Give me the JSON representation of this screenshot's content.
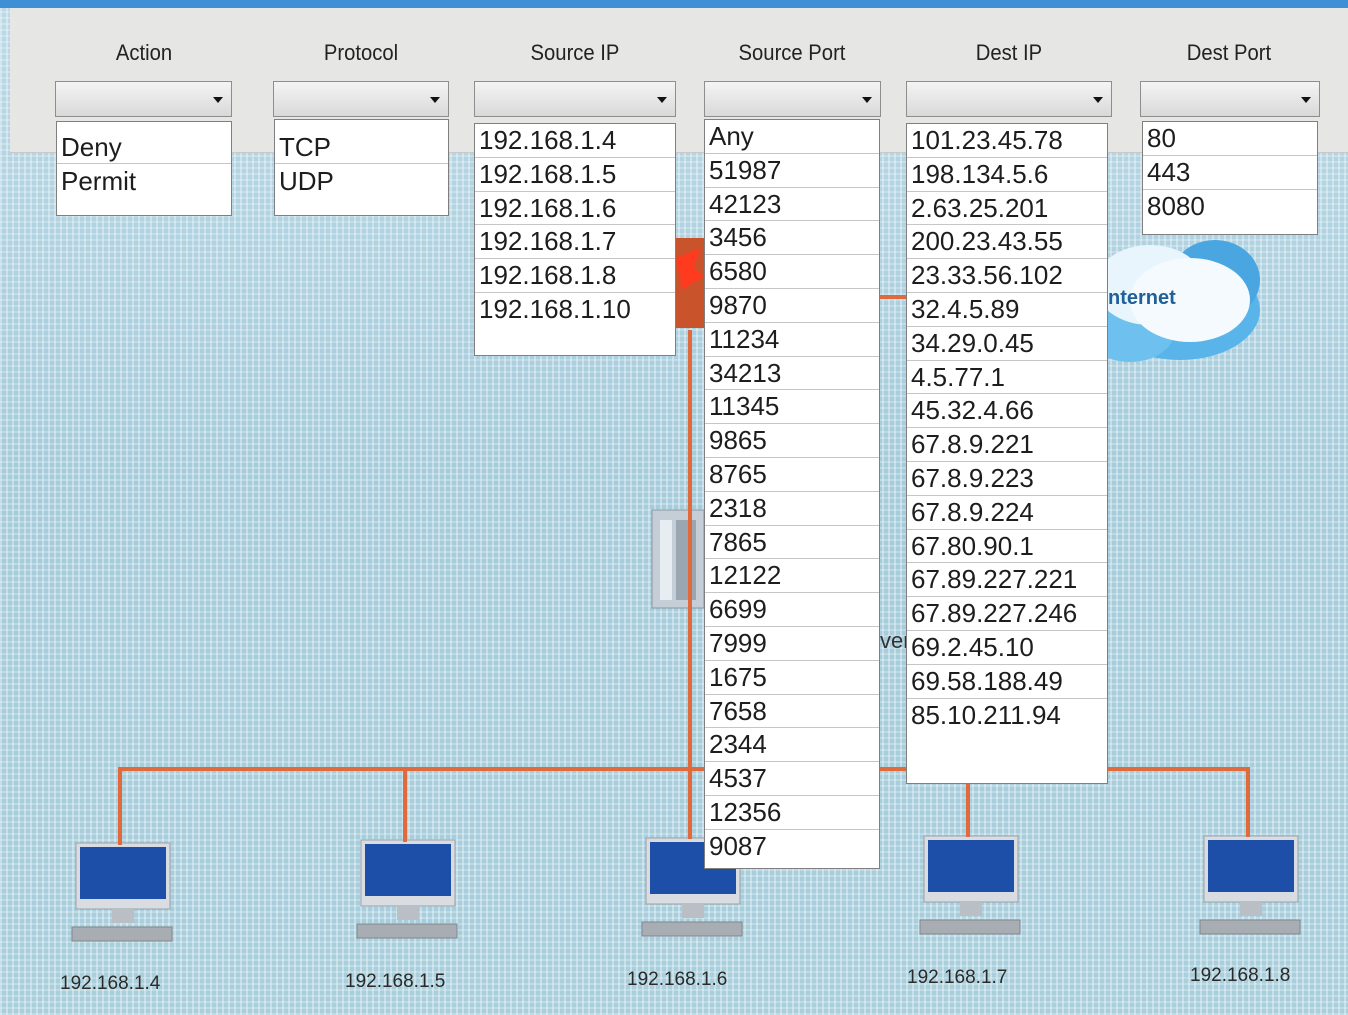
{
  "columns": {
    "action": {
      "title": "Action",
      "options": [
        "Deny",
        "Permit"
      ]
    },
    "protocol": {
      "title": "Protocol",
      "options": [
        "TCP",
        "UDP"
      ]
    },
    "source_ip": {
      "title": "Source IP",
      "options": [
        "192.168.1.4",
        "192.168.1.5",
        "192.168.1.6",
        "192.168.1.7",
        "192.168.1.8",
        "192.168.1.10"
      ]
    },
    "source_port": {
      "title": "Source Port",
      "options": [
        "Any",
        "51987",
        "42123",
        "3456",
        "6580",
        "9870",
        "11234",
        "34213",
        "11345",
        "9865",
        "8765",
        "2318",
        "7865",
        "12122",
        "6699",
        "7999",
        "1675",
        "7658",
        "2344",
        "4537",
        "12356",
        "9087"
      ]
    },
    "dest_ip": {
      "title": "Dest IP",
      "options": [
        "101.23.45.78",
        "198.134.5.6",
        "2.63.25.201",
        "200.23.43.55",
        "23.33.56.102",
        "32.4.5.89",
        "34.29.0.45",
        "4.5.77.1",
        "45.32.4.66",
        "67.8.9.221",
        "67.8.9.223",
        "67.8.9.224",
        "67.80.90.1",
        "67.89.227.221",
        "67.89.227.246",
        "69.2.45.10",
        "69.58.188.49",
        "85.10.211.94"
      ]
    },
    "dest_port": {
      "title": "Dest Port",
      "options": [
        "80",
        "443",
        "8080"
      ]
    }
  },
  "network": {
    "cloud_label": "nternet",
    "server_label_fragment": "ver",
    "hosts": [
      "192.168.1.4",
      "192.168.1.5",
      "192.168.1.6",
      "192.168.1.7",
      "192.168.1.8"
    ]
  },
  "colors": {
    "wire": "#e06a3c",
    "accent": "#3f8fd6",
    "cloud": "#59b4ea",
    "monitor": "#1d4fa8"
  },
  "icons": [
    "chevron-down-icon",
    "firewall-icon",
    "cloud-icon",
    "server-icon",
    "computer-icon"
  ]
}
